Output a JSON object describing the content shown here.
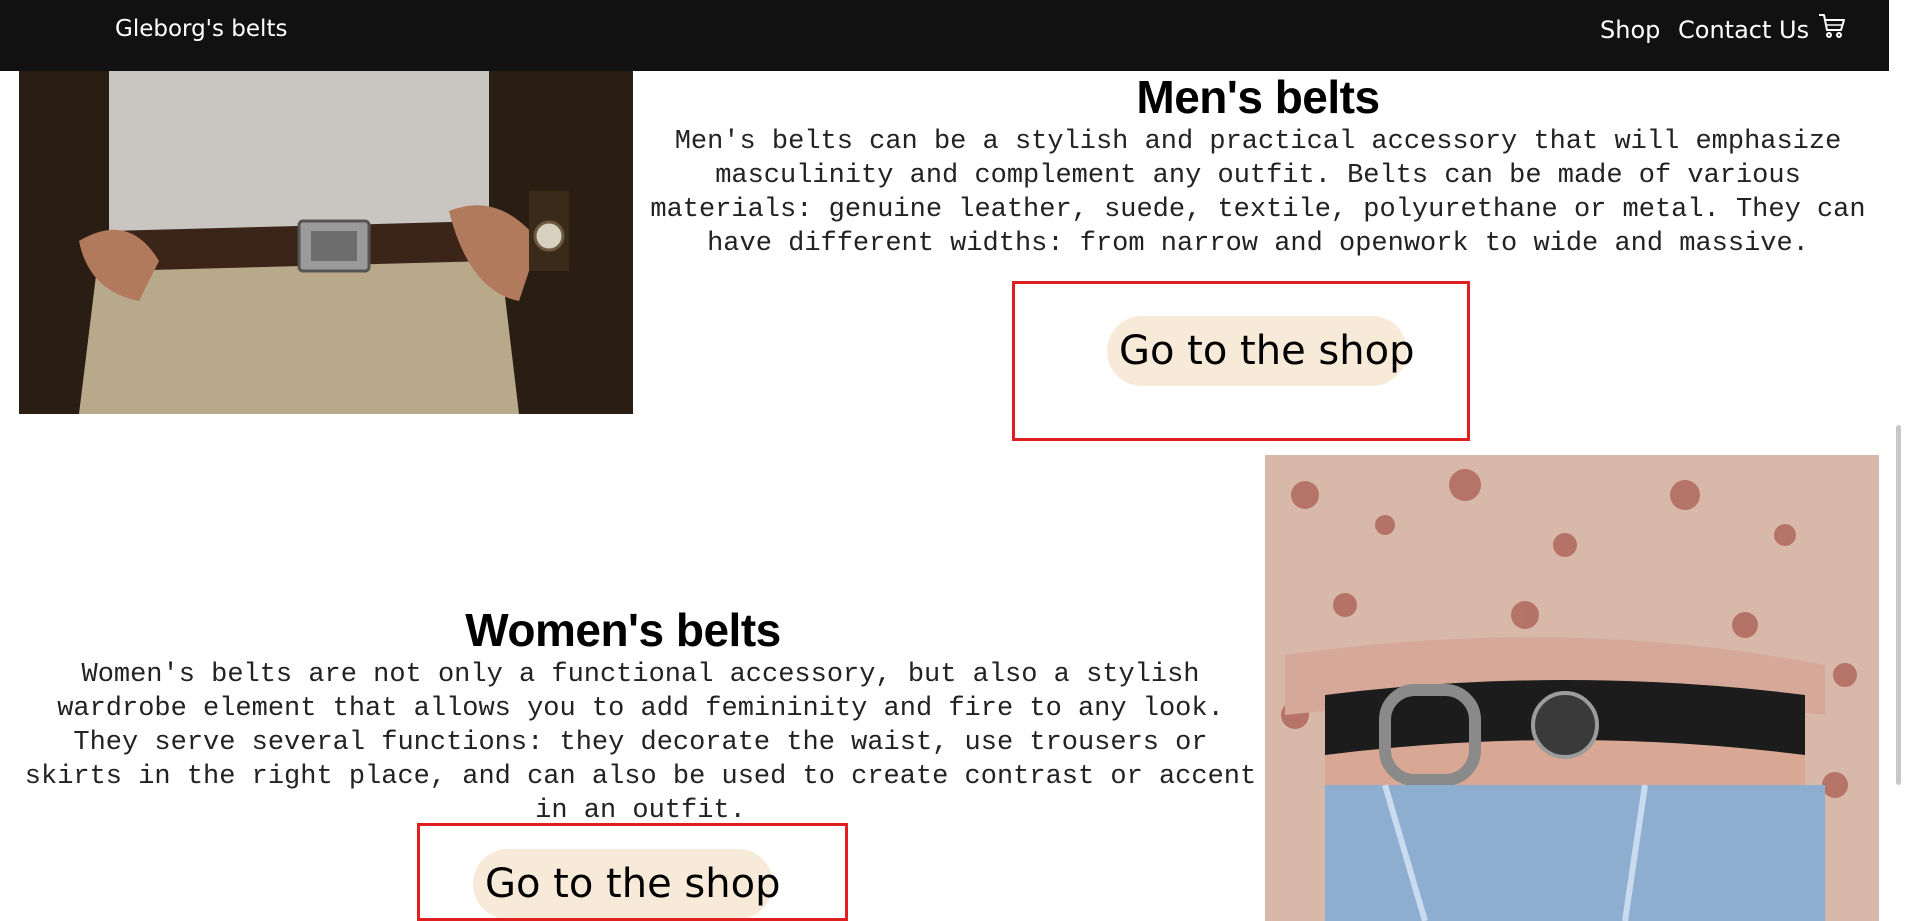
{
  "navbar": {
    "brand": "Gleborg's belts",
    "links": [
      "Shop",
      "Contact Us"
    ],
    "cart_icon": "cart-icon"
  },
  "sections": [
    {
      "title": "Men's belts",
      "description": "Men's belts can be a stylish and practical accessory that will emphasize masculinity and complement any outfit. Belts can be made of various materials: genuine leather, suede, textile, polyurethane or metal. They can have different widths: from narrow and openwork to wide and massive.",
      "button": "Go to the shop",
      "image": "mens-belt-photo"
    },
    {
      "title": "Women's belts",
      "description": "Women's belts are not only a functional accessory, but also a stylish wardrobe element that allows you to add femininity and fire to any look. They serve several functions: they decorate the waist, use trousers or skirts in the right place, and can also be used to create contrast or accent in an outfit.",
      "button": "Go to the shop",
      "image": "womens-belt-photo"
    }
  ],
  "colors": {
    "navbar_bg": "#111111",
    "button_bg": "#f8ead8",
    "highlight": "#e02020"
  }
}
